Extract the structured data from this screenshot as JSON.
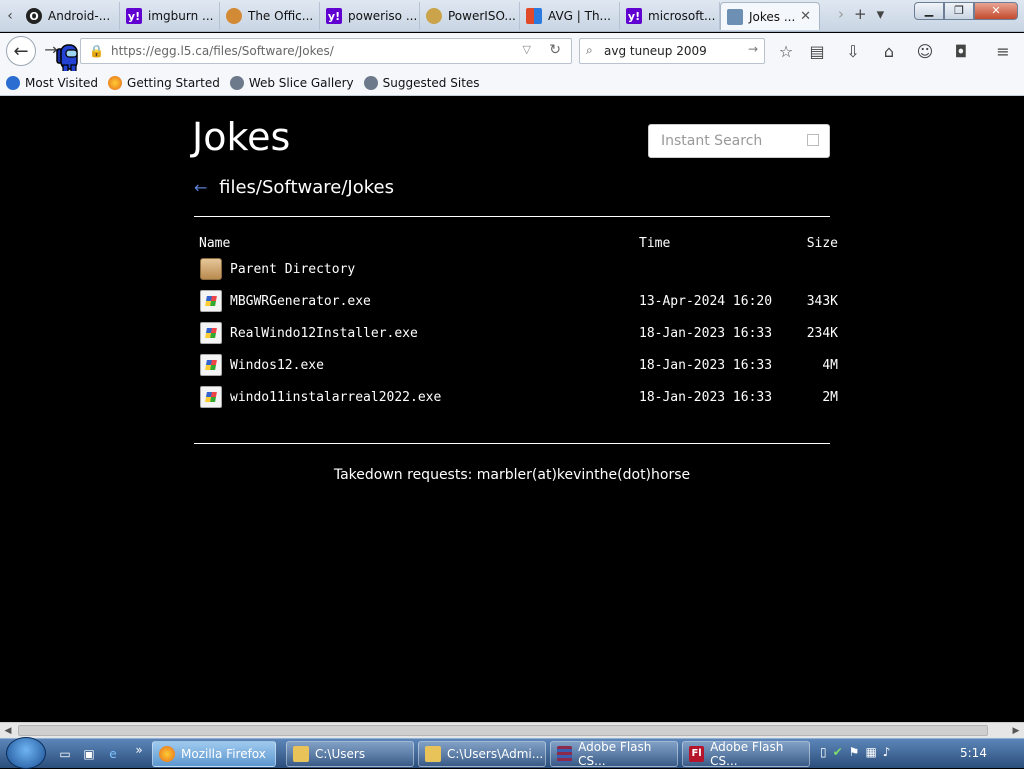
{
  "browser": {
    "tabs": [
      {
        "label": "Android-...",
        "icon": "opera-icon",
        "color": "#222222"
      },
      {
        "label": "imgburn ...",
        "icon": "yahoo-icon",
        "color": "#6001d2"
      },
      {
        "label": "The Offic...",
        "icon": "burn-icon",
        "color": "#d28a34"
      },
      {
        "label": "poweriso ...",
        "icon": "yahoo-icon",
        "color": "#6001d2"
      },
      {
        "label": "PowerISO...",
        "icon": "disc-icon",
        "color": "#caa34a"
      },
      {
        "label": "AVG | Th...",
        "icon": "avg-icon",
        "color": "#e04a2a"
      },
      {
        "label": "microsoft...",
        "icon": "yahoo-icon",
        "color": "#6001d2"
      },
      {
        "label": "Jokes ...",
        "icon": "page-icon",
        "color": "#6d8fb3"
      }
    ],
    "tab_close_symbol": "✕",
    "tab_controls": {
      "scroll_right": "›",
      "new_tab": "+",
      "list_all": "▾"
    },
    "window_buttons": {
      "minimize": "▁",
      "maximize": "❐",
      "close": "✕"
    },
    "url": "https://egg.l5.ca/files/Software/Jokes/",
    "search_value": "avg tuneup 2009",
    "bookmarks": [
      {
        "label": "Most Visited",
        "icon": "star-icon",
        "color": "#2c6dd1"
      },
      {
        "label": "Getting Started",
        "icon": "firefox-icon",
        "color": "#e66a1c"
      },
      {
        "label": "Web Slice Gallery",
        "icon": "ie-icon",
        "color": "#6c7a8c"
      },
      {
        "label": "Suggested Sites",
        "icon": "ie-icon",
        "color": "#6c7a8c"
      }
    ]
  },
  "page": {
    "title": "Jokes",
    "search_placeholder": "Instant Search",
    "back_arrow": "←",
    "path": "files/Software/Jokes",
    "columns": {
      "name": "Name",
      "time": "Time",
      "size": "Size"
    },
    "rows": [
      {
        "name": "Parent Directory",
        "time": "",
        "size": "",
        "icon": "folder-icon"
      },
      {
        "name": "MBGWRGenerator.exe",
        "time": "13-Apr-2024 16:20",
        "size": "343K",
        "icon": "exe-icon"
      },
      {
        "name": "RealWindo12Installer.exe",
        "time": "18-Jan-2023 16:33",
        "size": "234K",
        "icon": "exe-icon"
      },
      {
        "name": "Windos12.exe",
        "time": "18-Jan-2023 16:33",
        "size": "4M",
        "icon": "exe-icon"
      },
      {
        "name": "windo11instalarreal2022.exe",
        "time": "18-Jan-2023 16:33",
        "size": "2M",
        "icon": "exe-icon"
      }
    ],
    "footer": "Takedown requests: marbler(at)kevinthe(dot)horse"
  },
  "taskbar": {
    "tasks": [
      {
        "label": "Mozilla Firefox",
        "icon": "firefox-icon",
        "color": "#e66a1c",
        "active": true
      },
      {
        "label": "C:\\Users",
        "icon": "folder-icon",
        "color": "#e8c35a",
        "active": false
      },
      {
        "label": "C:\\Users\\Admi...",
        "icon": "folder-icon",
        "color": "#e8c35a",
        "active": false
      },
      {
        "label": "Adobe Flash CS...",
        "icon": "winrar-icon",
        "color": "#8b2a4a",
        "active": false
      },
      {
        "label": "Adobe Flash CS...",
        "icon": "flash-icon",
        "color": "#b5142a",
        "active": false
      }
    ],
    "clock": "5:14"
  }
}
